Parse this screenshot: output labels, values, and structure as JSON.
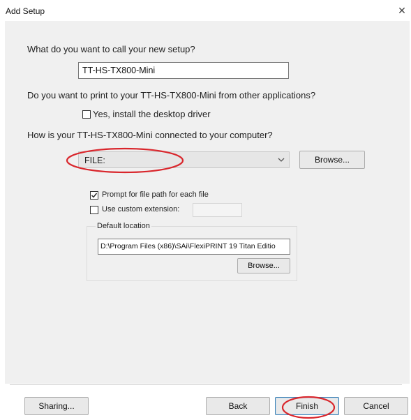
{
  "window": {
    "title": "Add Setup",
    "close_glyph": "✕"
  },
  "setup_name": {
    "question": "What do you want to call your new setup?",
    "value": "TT-HS-TX800-Mini"
  },
  "print_from_apps": {
    "question": "Do you want to print to your TT-HS-TX800-Mini from other applications?",
    "checkbox_label": "Yes, install the desktop driver",
    "checked": false
  },
  "connection": {
    "question": "How is your TT-HS-TX800-Mini connected to your computer?",
    "selected_port": "FILE:",
    "browse_label": "Browse..."
  },
  "file_options": {
    "prompt_label": "Prompt for file path for each file",
    "prompt_checked": true,
    "custom_ext_label": "Use custom extension:",
    "custom_ext_checked": false,
    "default_location_label": "Default location",
    "default_location_value": "D:\\Program Files (x86)\\SAi\\FlexiPRINT 19 Titan Editio",
    "browse_label": "Browse..."
  },
  "footer": {
    "sharing_label": "Sharing...",
    "back_label": "Back",
    "finish_label": "Finish",
    "cancel_label": "Cancel"
  },
  "annotations": {
    "highlight_color": "#d9262c"
  },
  "icons": [
    "close-icon",
    "checkbox-icon",
    "chevron-down-icon"
  ]
}
